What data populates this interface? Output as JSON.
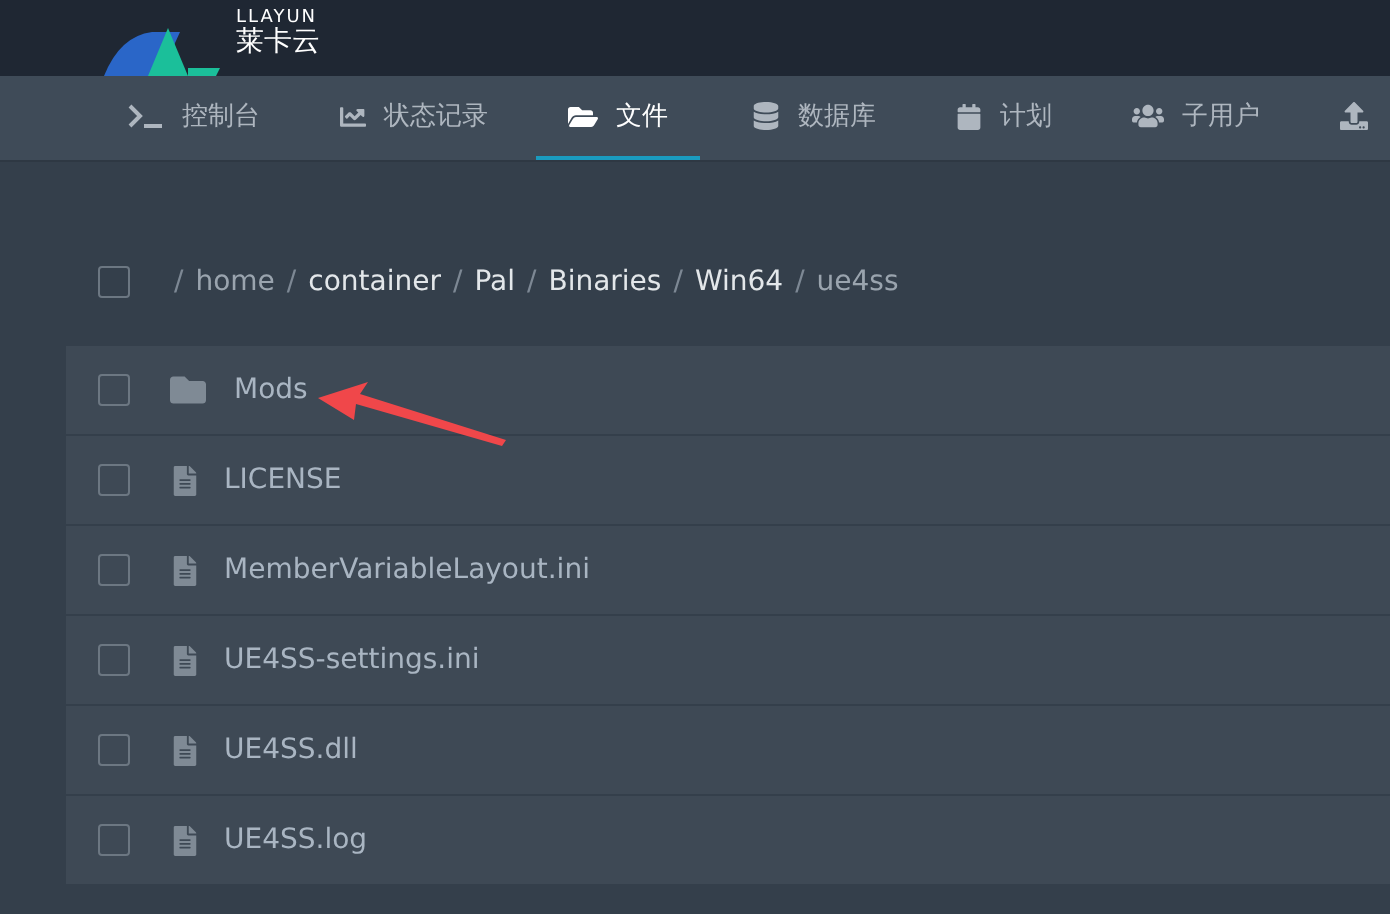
{
  "header": {
    "logo_text": "LLAYUN",
    "logo_subtitle": "莱卡云"
  },
  "tabs": [
    {
      "label": "控制台",
      "selected": false
    },
    {
      "label": "状态记录",
      "selected": false
    },
    {
      "label": "文件",
      "selected": true
    },
    {
      "label": "数据库",
      "selected": false
    },
    {
      "label": "计划",
      "selected": false
    },
    {
      "label": "子用户",
      "selected": false
    },
    {
      "selected": false
    }
  ],
  "breadcrumb": {
    "checked": false,
    "segments": [
      {
        "separator": "/",
        "label": "home",
        "muted": true
      },
      {
        "separator": "/",
        "label": "container",
        "muted": false
      },
      {
        "separator": "/",
        "label": "Pal",
        "muted": false
      },
      {
        "separator": "/",
        "label": "Binaries",
        "muted": false
      },
      {
        "separator": "/",
        "label": "Win64",
        "muted": false
      },
      {
        "separator": "/",
        "label": "ue4ss",
        "muted": true
      }
    ]
  },
  "files": [
    {
      "name": "Mods",
      "kind": "folder",
      "checked": false
    },
    {
      "name": "LICENSE",
      "kind": "file",
      "checked": false
    },
    {
      "name": "MemberVariableLayout.ini",
      "kind": "file",
      "checked": false
    },
    {
      "name": "UE4SS-settings.ini",
      "kind": "file",
      "checked": false
    },
    {
      "name": "UE4SS.dll",
      "kind": "file",
      "checked": false
    },
    {
      "name": "UE4SS.log",
      "kind": "file",
      "checked": false
    }
  ],
  "annotation": {
    "kind": "arrow"
  }
}
